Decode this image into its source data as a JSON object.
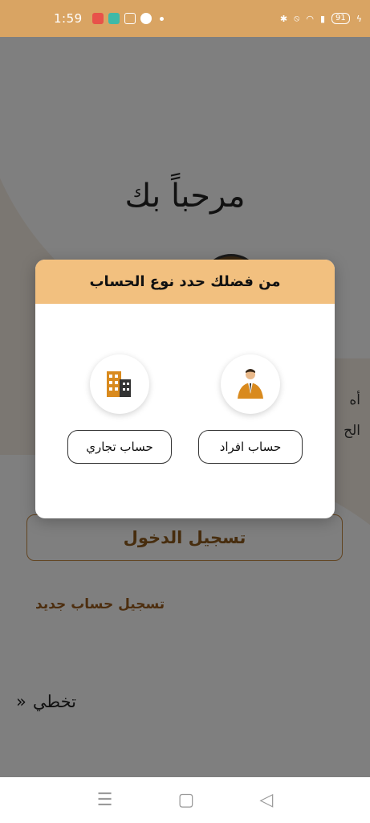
{
  "status_bar": {
    "time": "1:59",
    "battery": "91"
  },
  "background": {
    "welcome_title": "مرحباً بك",
    "side_text_1": "أه",
    "side_text_2": "الح",
    "login_button": "تسجيل الدخول",
    "register_link": "تسجيل حساب جديد",
    "skip_label": "تخطي",
    "skip_icon": "»"
  },
  "dialog": {
    "title": "من فضلك حدد نوع الحساب",
    "options": [
      {
        "label": "حساب افراد",
        "icon": "person-icon"
      },
      {
        "label": "حساب تجاري",
        "icon": "building-icon"
      }
    ]
  },
  "nav": {
    "menu_icon": "☰",
    "home_icon": "▢",
    "back_icon": "◁"
  },
  "colors": {
    "accent": "#d9a463",
    "dialog_header": "#f2c07f",
    "brown": "#8f5a1c"
  }
}
